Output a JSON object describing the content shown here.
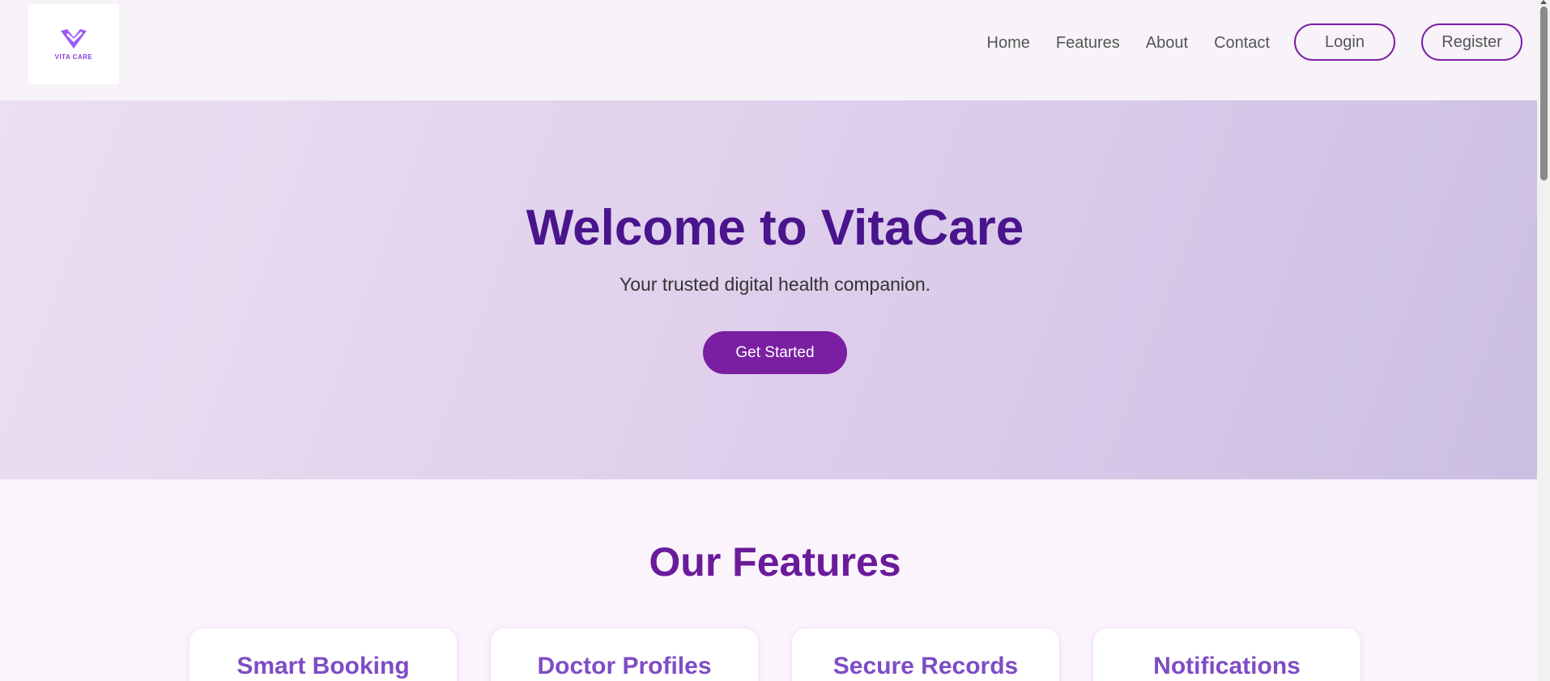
{
  "brand": {
    "logo_text": "VITA CARE",
    "primary_color": "#7a1fa2",
    "dark_purple": "#4a148c",
    "icon": "heart-check-icon"
  },
  "nav": {
    "links": [
      "Home",
      "Features",
      "About",
      "Contact"
    ],
    "login_label": "Login",
    "register_label": "Register"
  },
  "hero": {
    "title": "Welcome to VitaCare",
    "subtitle": "Your trusted digital health companion.",
    "cta_label": "Get Started"
  },
  "features": {
    "heading": "Our Features",
    "items": [
      {
        "title": "Smart Booking"
      },
      {
        "title": "Doctor Profiles"
      },
      {
        "title": "Secure Records"
      },
      {
        "title": "Notifications"
      }
    ]
  }
}
